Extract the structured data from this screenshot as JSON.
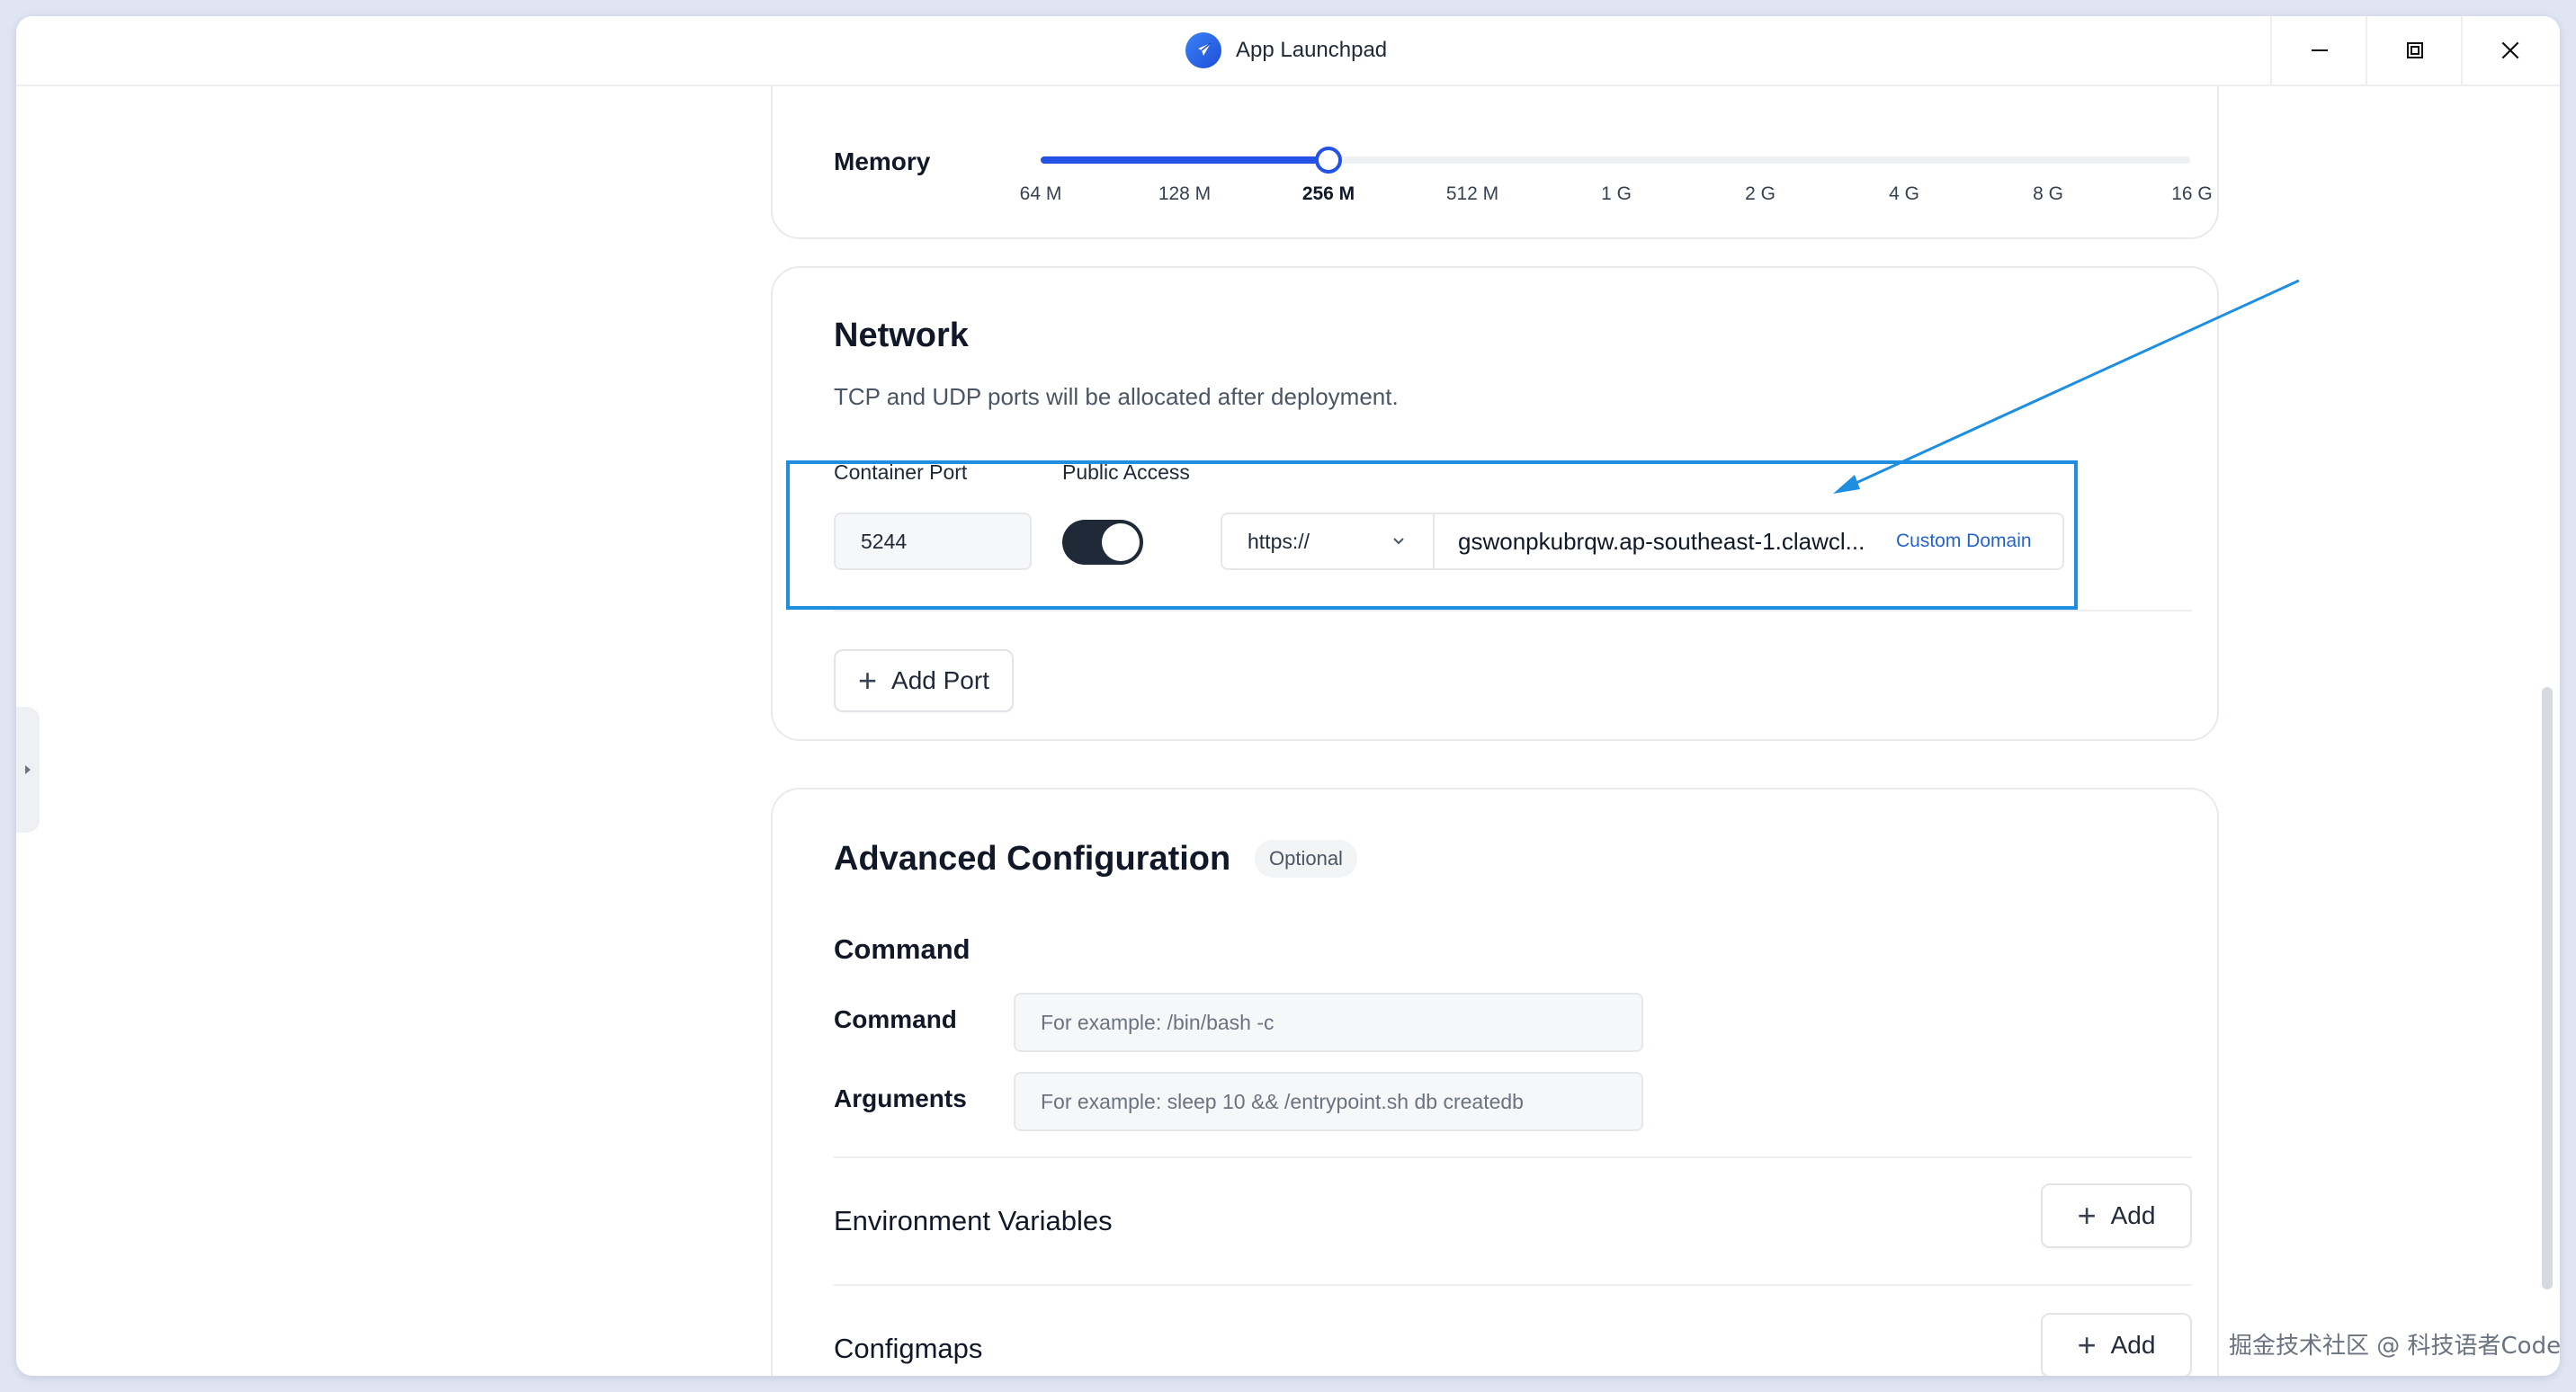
{
  "window": {
    "title": "App Launchpad"
  },
  "memory": {
    "label": "Memory",
    "ticks": [
      "64 M",
      "128 M",
      "256 M",
      "512 M",
      "1 G",
      "2 G",
      "4 G",
      "8 G",
      "16 G"
    ],
    "selected": "256 M"
  },
  "network": {
    "title": "Network",
    "subtitle": "TCP and UDP ports will be allocated after deployment.",
    "container_port_label": "Container Port",
    "public_access_label": "Public Access",
    "port_value": "5244",
    "public_access_enabled": true,
    "protocol": "https://",
    "domain": "gswonpkubrqw.ap-southeast-1.clawcl...",
    "custom_domain_label": "Custom Domain",
    "add_port_label": "Add Port"
  },
  "advanced": {
    "title": "Advanced Configuration",
    "badge": "Optional",
    "command_section": "Command",
    "command_label": "Command",
    "command_placeholder": "For example:  /bin/bash -c",
    "arguments_label": "Arguments",
    "arguments_placeholder": "For example:  sleep 10 && /entrypoint.sh db createdb",
    "env_label": "Environment Variables",
    "configmaps_label": "Configmaps",
    "add_label": "Add"
  },
  "watermark": "掘金技术社区 @ 科技语者Code",
  "colors": {
    "accent": "#2451e6",
    "highlight": "#1e8fe0",
    "link": "#2563c9"
  }
}
